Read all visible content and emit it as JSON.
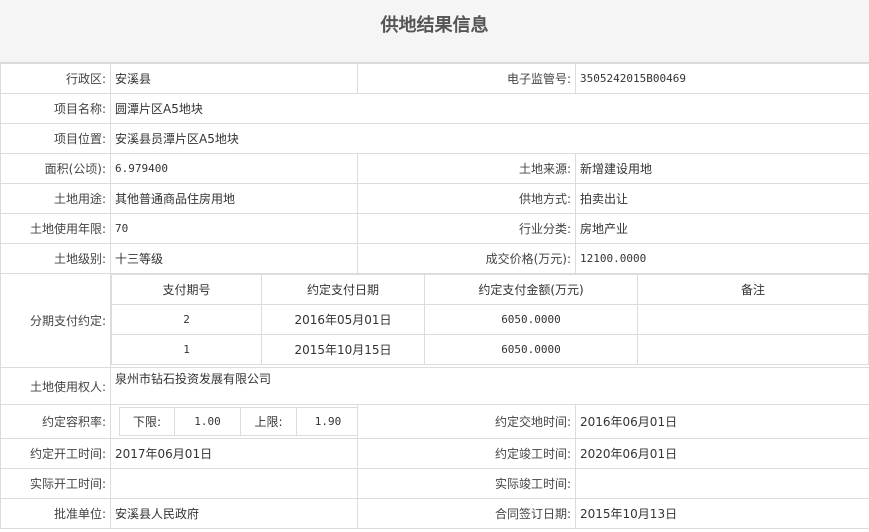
{
  "title": "供地结果信息",
  "labels": {
    "district": "行政区:",
    "monitor_no": "电子监管号:",
    "project_name": "项目名称:",
    "project_location": "项目位置:",
    "area": "面积(公顷):",
    "land_source": "土地来源:",
    "land_use": "土地用途:",
    "supply_method": "供地方式:",
    "use_term": "土地使用年限:",
    "industry": "行业分类:",
    "land_grade": "土地级别:",
    "deal_price": "成交价格(万元):",
    "installments": "分期支付约定:",
    "land_user": "土地使用权人:",
    "far": "约定容积率:",
    "delivery_date": "约定交地时间:",
    "start_date": "约定开工时间:",
    "complete_date": "约定竣工时间:",
    "actual_start": "实际开工时间:",
    "actual_complete": "实际竣工时间:",
    "approver": "批准单位:",
    "contract_date": "合同签订日期:"
  },
  "values": {
    "district": "安溪县",
    "monitor_no": "3505242015B00469",
    "project_name": "圆潭片区A5地块",
    "project_location": "安溪县员潭片区A5地块",
    "area": "6.979400",
    "land_source": "新增建设用地",
    "land_use": "其他普通商品住房用地",
    "supply_method": "拍卖出让",
    "use_term": "70",
    "industry": "房地产业",
    "land_grade": "十三等级",
    "deal_price": "12100.0000",
    "land_user": "泉州市钻石投资发展有限公司",
    "delivery_date": "2016年06月01日",
    "start_date": "2017年06月01日",
    "complete_date": "2020年06月01日",
    "actual_start": "",
    "actual_complete": "",
    "approver": "安溪县人民政府",
    "contract_date": "2015年10月13日"
  },
  "installments": {
    "headers": [
      "支付期号",
      "约定支付日期",
      "约定支付金额(万元)",
      "备注"
    ],
    "rows": [
      {
        "period": "2",
        "date": "2016年05月01日",
        "amount": "6050.0000",
        "note": ""
      },
      {
        "period": "1",
        "date": "2015年10月15日",
        "amount": "6050.0000",
        "note": ""
      }
    ]
  },
  "far": {
    "lower_label": "下限:",
    "lower_value": "1.00",
    "upper_label": "上限:",
    "upper_value": "1.90"
  }
}
